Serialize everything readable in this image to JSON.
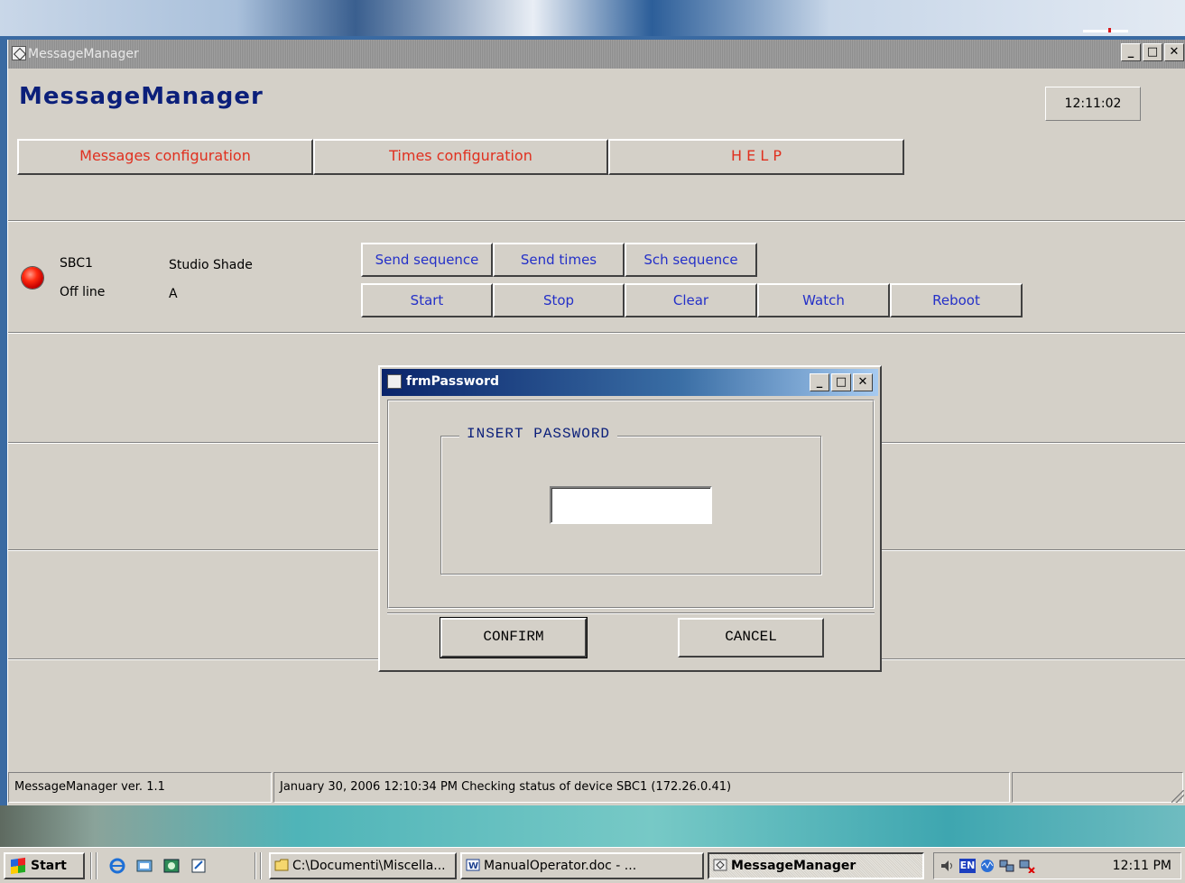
{
  "window": {
    "title": "MessageManager",
    "heading": "MessageManager",
    "clock": "12:11:02",
    "menu": [
      {
        "label": "Messages configuration"
      },
      {
        "label": "Times configuration"
      },
      {
        "label": "H E L P"
      }
    ]
  },
  "device": {
    "name": "SBC1",
    "state": "Off line",
    "location": "Studio Shade",
    "code": "A",
    "status_color": "#e0100a"
  },
  "commands": {
    "row1": [
      "Send sequence",
      "Send times",
      "Sch sequence"
    ],
    "row2": [
      "Start",
      "Stop",
      "Clear",
      "Watch",
      "Reboot"
    ]
  },
  "dialog": {
    "title": "frmPassword",
    "group_label": "INSERT PASSWORD",
    "password_value": "",
    "confirm_label": "CONFIRM",
    "cancel_label": "CANCEL"
  },
  "statusbar": {
    "version": "MessageManager ver. 1.1",
    "message": "January 30, 2006 12:10:34 PM Checking status of device SBC1 (172.26.0.41)",
    "extra": ""
  },
  "taskbar": {
    "start_label": "Start",
    "tasks": [
      {
        "label": "C:\\Documenti\\Miscella...",
        "icon": "folder-icon"
      },
      {
        "label": "ManualOperator.doc - ...",
        "icon": "word-document-icon"
      },
      {
        "label": "MessageManager",
        "icon": "app-icon"
      }
    ],
    "tray_lang": "EN",
    "clock": "12:11 PM"
  },
  "colors": {
    "menu_text": "#e0301f",
    "command_text": "#2430c8",
    "heading": "#0b1f7a"
  }
}
